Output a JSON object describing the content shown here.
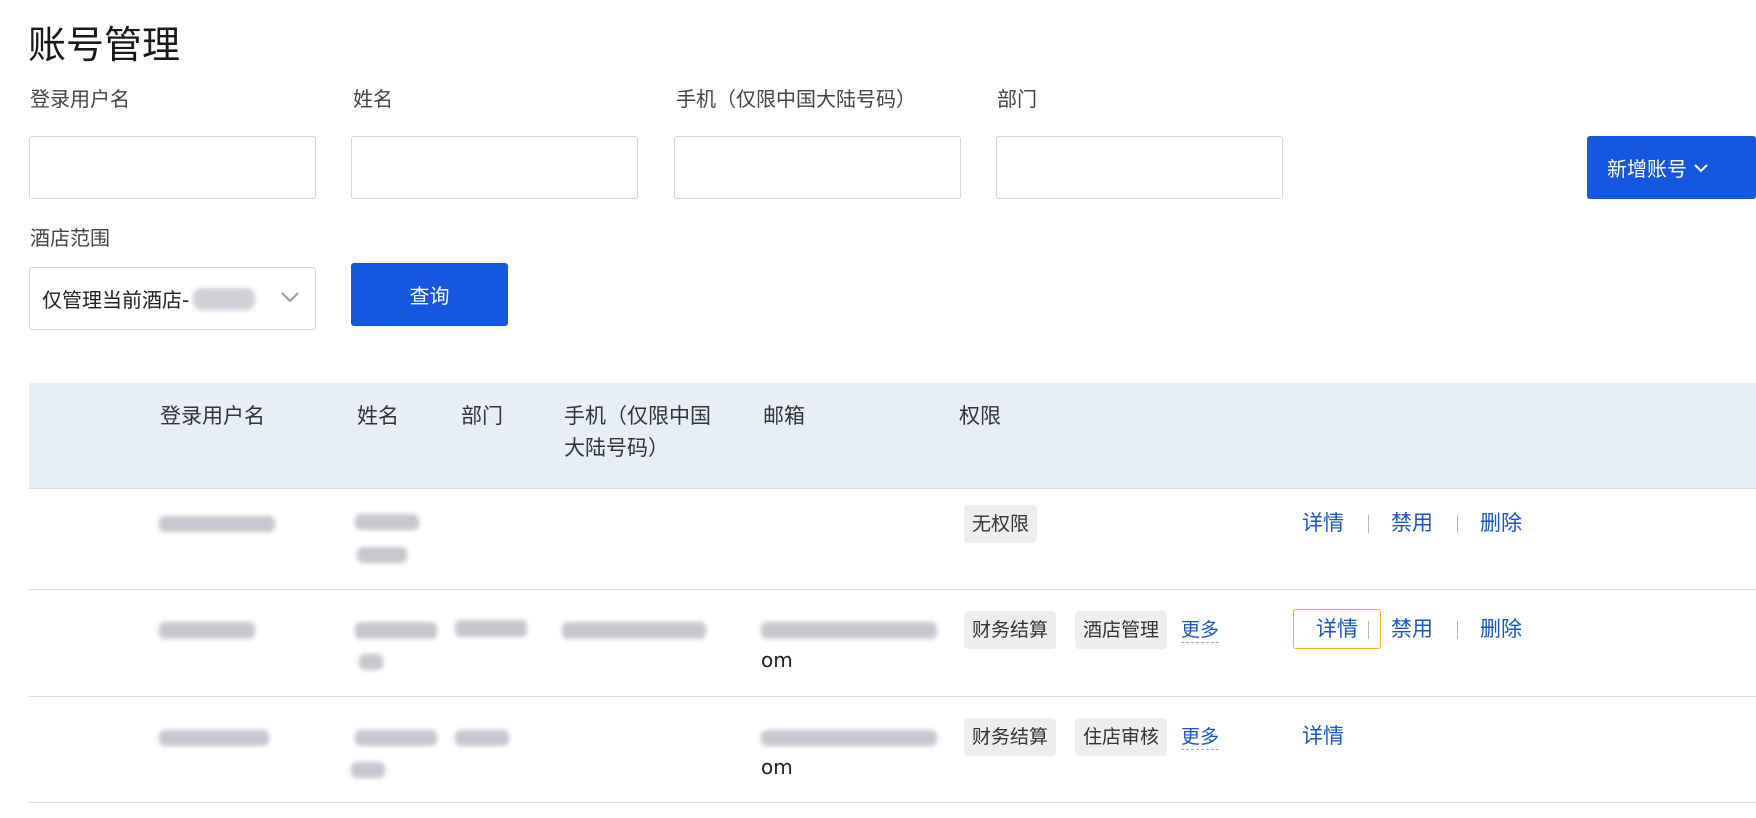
{
  "page": {
    "title": "账号管理"
  },
  "filters": {
    "username_label": "登录用户名",
    "name_label": "姓名",
    "phone_label": "手机（仅限中国大陆号码）",
    "dept_label": "部门",
    "hotel_scope_label": "酒店范围",
    "hotel_scope_value": "仅管理当前酒店-",
    "query_button": "查询",
    "add_account_button": "新增账号"
  },
  "table": {
    "columns": [
      "登录用户名",
      "姓名",
      "部门",
      "手机（仅限中国",
      "大陆号码）",
      "邮箱",
      "权限"
    ],
    "rows": [
      {
        "permissions": [
          "无权限"
        ],
        "actions": [
          "详情",
          "禁用",
          "删除"
        ]
      },
      {
        "email_suffix": "om",
        "permissions": [
          "财务结算",
          "酒店管理"
        ],
        "more": "更多",
        "actions": [
          "详情",
          "禁用",
          "删除"
        ]
      },
      {
        "email_suffix": "om",
        "permissions": [
          "财务结算",
          "住店审核"
        ],
        "more": "更多",
        "actions": [
          "详情"
        ]
      }
    ]
  },
  "colors": {
    "primary": "#1657e0",
    "link": "#1a56c8",
    "header_bg": "#e8eef8",
    "focus": "#f0b41e"
  },
  "icons": {
    "select_chevron": "chevron-down-icon",
    "add_chevron": "chevron-down-icon"
  }
}
